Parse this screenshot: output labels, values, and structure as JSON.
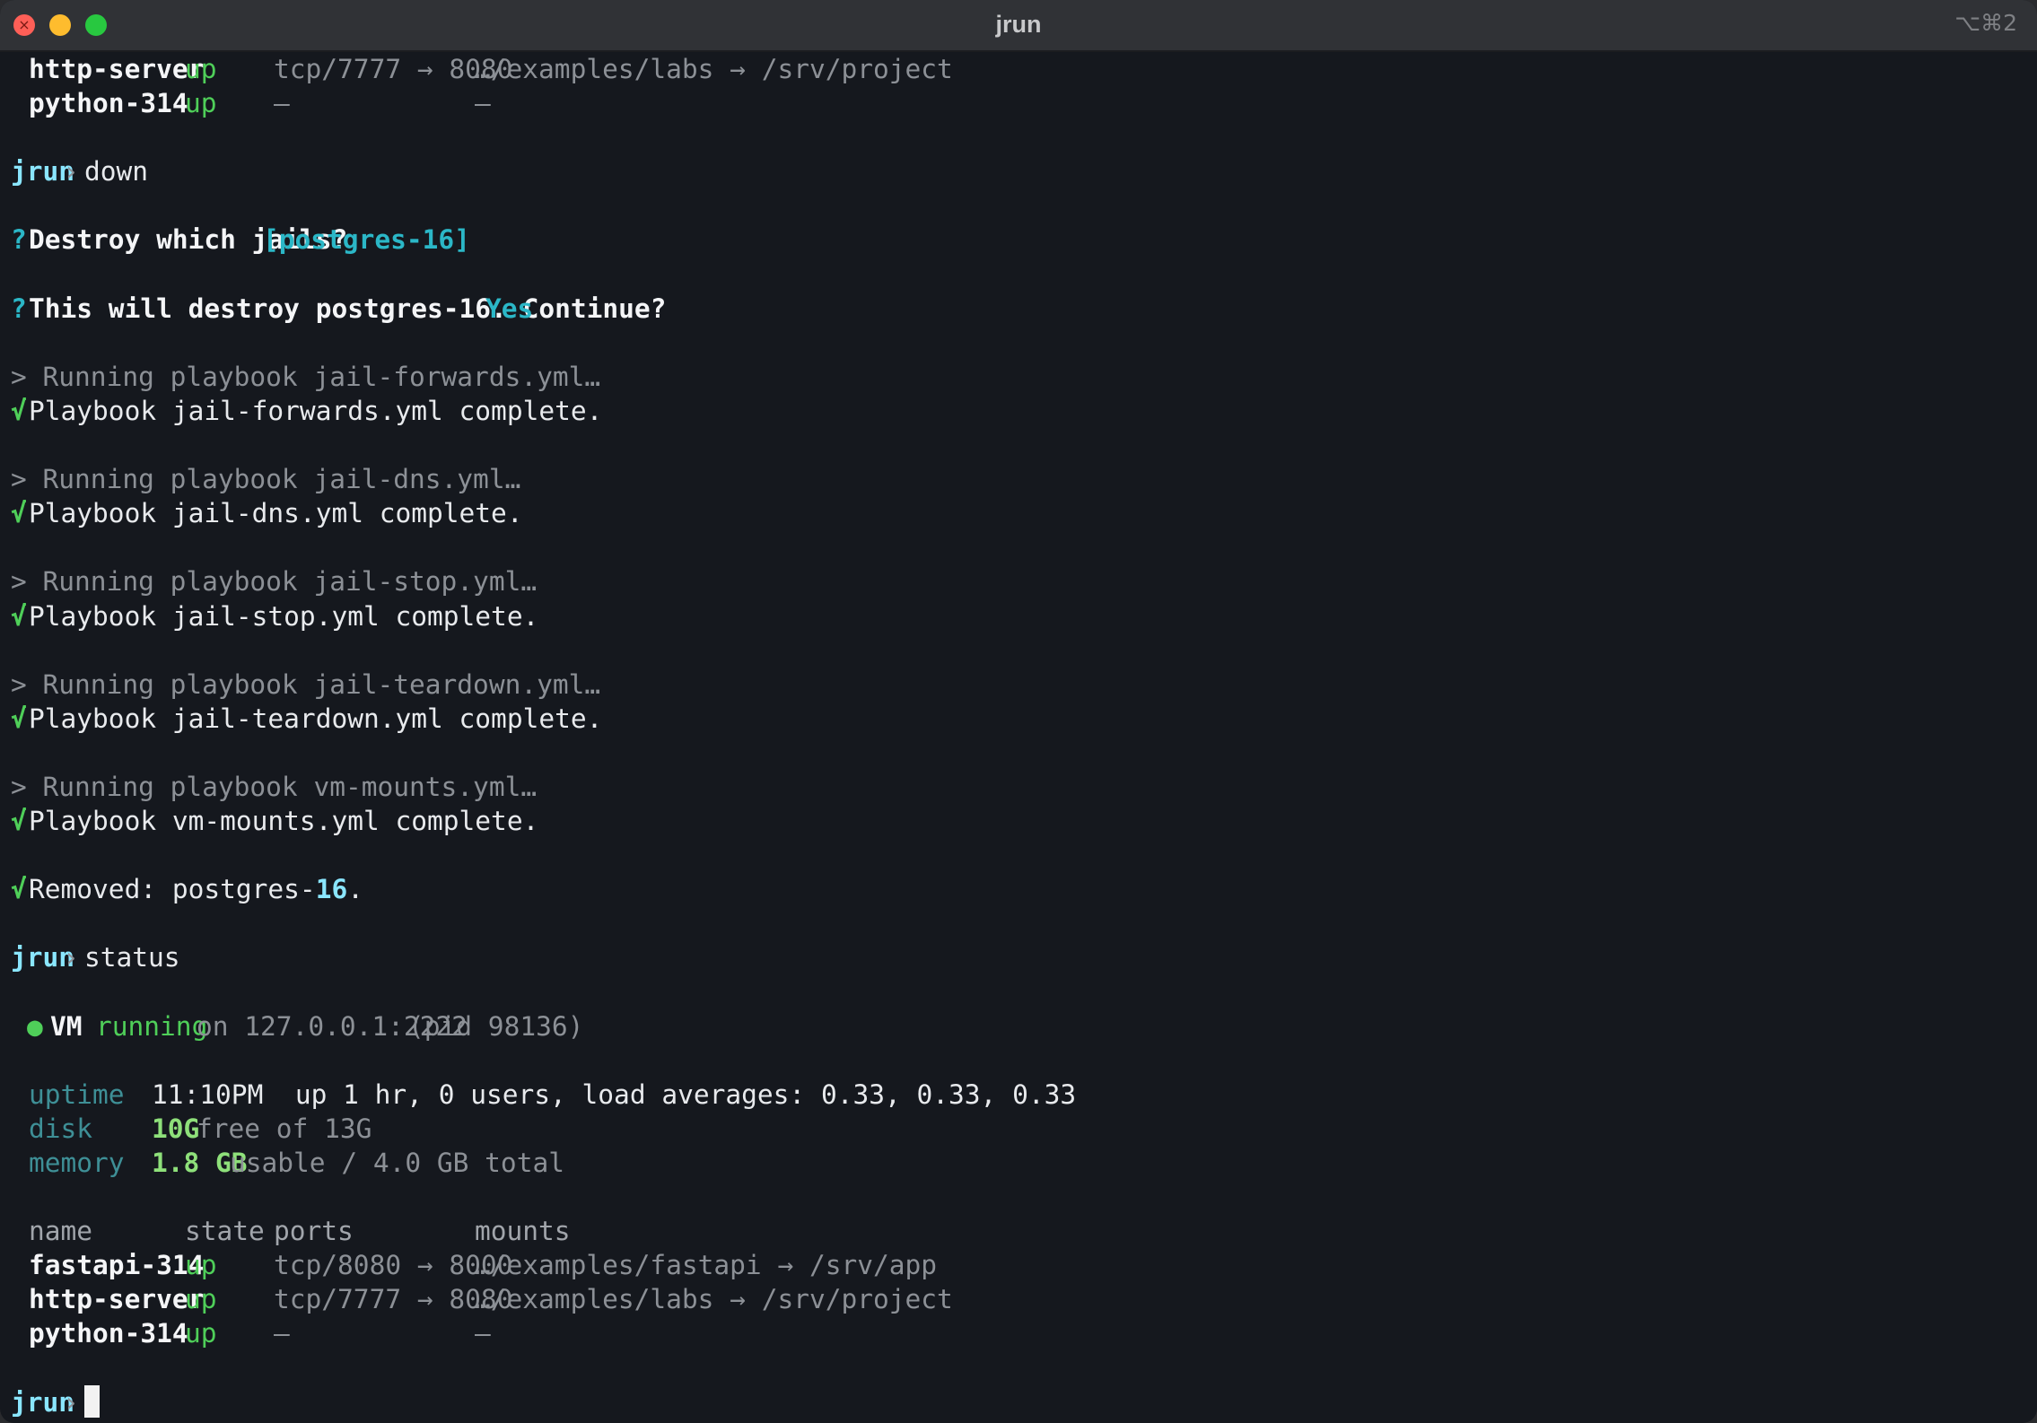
{
  "window": {
    "title": "jrun",
    "shortcut": "⌥⌘2"
  },
  "prompt": {
    "name": "jrun",
    "arrow": "›"
  },
  "top_rows": [
    {
      "name": "http-server",
      "state": "up",
      "ports": "tcp/7777 → 8080",
      "mounts": "…/examples/labs → /srv/project"
    },
    {
      "name": "python-314",
      "state": "up",
      "ports": "—",
      "mounts": "—"
    }
  ],
  "cmd_down": "down",
  "question1": {
    "mark": "?",
    "text": "Destroy which jails?",
    "answer": "[postgres-16]"
  },
  "question2": {
    "mark": "?",
    "text": "This will destroy postgres-16. Continue?",
    "answer": "Yes"
  },
  "playbooks": [
    {
      "running": "> Running playbook jail-forwards.yml…",
      "complete": "Playbook jail-forwards.yml complete."
    },
    {
      "running": "> Running playbook jail-dns.yml…",
      "complete": "Playbook jail-dns.yml complete."
    },
    {
      "running": "> Running playbook jail-stop.yml…",
      "complete": "Playbook jail-stop.yml complete."
    },
    {
      "running": "> Running playbook jail-teardown.yml…",
      "complete": "Playbook jail-teardown.yml complete."
    },
    {
      "running": "> Running playbook vm-mounts.yml…",
      "complete": "Playbook vm-mounts.yml complete."
    }
  ],
  "check": "√",
  "removed": {
    "prefix": "Removed: postgres-",
    "version": "16",
    "suffix": "."
  },
  "cmd_status": "status",
  "vm": {
    "dot": "●",
    "label": "VM",
    "state": "running",
    "host": "on 127.0.0.1:2222",
    "pid": "(pid 98136)"
  },
  "stats": {
    "uptime_label": "uptime",
    "uptime_value": "11:10PM  up 1 hr, 0 users, load averages: 0.33, 0.33, 0.33",
    "disk_label": "disk",
    "disk_value": "10G",
    "disk_rest": "free of 13G",
    "memory_label": "memory",
    "memory_value": "1.8 GB",
    "memory_rest": "usable / 4.0 GB total"
  },
  "table": {
    "headers": {
      "name": "name",
      "state": "state",
      "ports": "ports",
      "mounts": "mounts"
    },
    "rows": [
      {
        "name": "fastapi-314",
        "state": "up",
        "ports": "tcp/8080 → 8000",
        "mounts": "…/examples/fastapi → /srv/app"
      },
      {
        "name": "http-server",
        "state": "up",
        "ports": "tcp/7777 → 8080",
        "mounts": "…/examples/labs → /srv/project"
      },
      {
        "name": "python-314",
        "state": "up",
        "ports": "—",
        "mounts": "—"
      }
    ]
  }
}
